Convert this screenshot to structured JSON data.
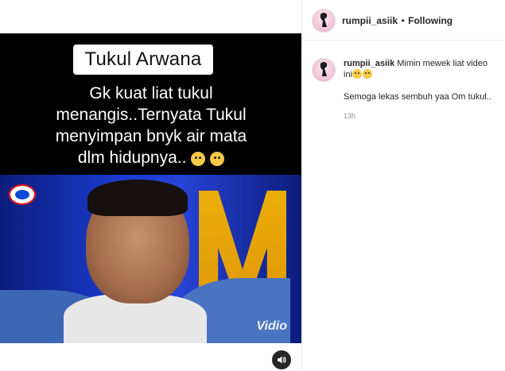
{
  "post": {
    "overlay_title": "Tukul Arwana",
    "overlay_caption_lines": [
      "Gk kuat liat tukul",
      "menangis..Ternyata Tukul",
      "menyimpan bnyk air mata",
      "dlm hidupnya.."
    ],
    "watermark": "Vidio"
  },
  "header": {
    "username": "rumpii_asiik",
    "separator": "•",
    "follow_status": "Following"
  },
  "comments": [
    {
      "username": "rumpii_asiik",
      "text_line1": "Mimin mewek liat video",
      "text_line2": "ini",
      "text_line3": "Semoga lekas sembuh yaa Om tukul..",
      "time": "13h"
    }
  ],
  "icons": {
    "audio": "speaker-icon",
    "avatar": "profile-avatar",
    "channel_logo": "indosiar-logo",
    "emoji": "crying-face-emoji"
  },
  "colors": {
    "stage_blue": "#1b3bd0",
    "stage_yellow": "#f6b300",
    "border": "#efefef",
    "muted_text": "#8e8e8e"
  }
}
